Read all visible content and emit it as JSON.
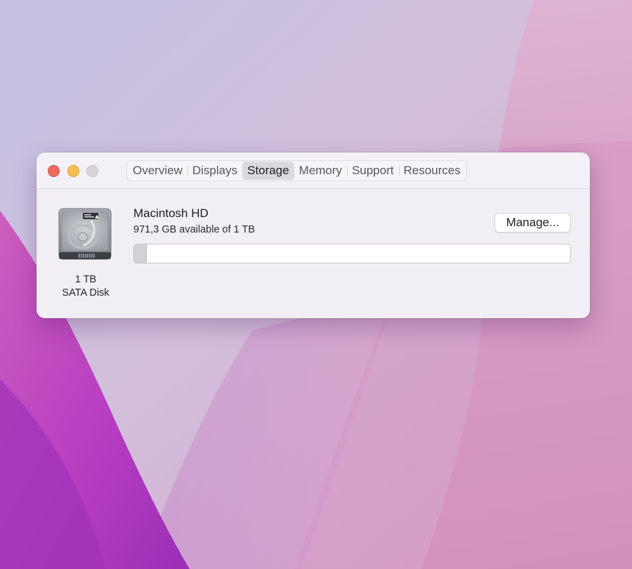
{
  "window": {
    "tabs": [
      {
        "label": "Overview",
        "active": false
      },
      {
        "label": "Displays",
        "active": false
      },
      {
        "label": "Storage",
        "active": true
      },
      {
        "label": "Memory",
        "active": false
      },
      {
        "label": "Support",
        "active": false
      },
      {
        "label": "Resources",
        "active": false
      }
    ]
  },
  "storage": {
    "disk": {
      "icon": "hard-drive-icon",
      "capacity": "1 TB",
      "type": "SATA Disk"
    },
    "volume": {
      "name": "Macintosh HD",
      "available_text": "971,3 GB available of 1 TB",
      "used_fraction": 0.029
    },
    "manage_label": "Manage..."
  },
  "colors": {
    "close": "#ed6a5e",
    "minimize": "#f5bf4f",
    "zoom": "#d6d4d8",
    "wallpaper_magenta": "#b23fc0",
    "wallpaper_lavender": "#c9bedf"
  }
}
